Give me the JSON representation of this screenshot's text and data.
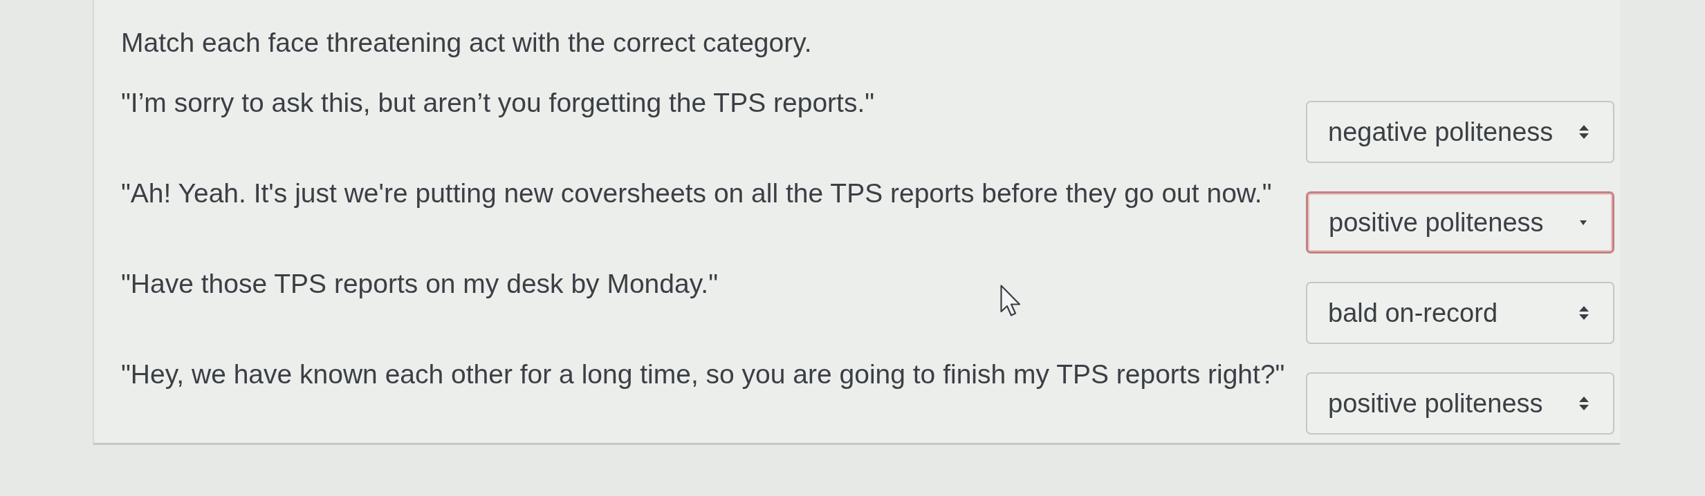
{
  "instruction": "Match each face threatening act with the correct category.",
  "items": [
    {
      "prompt": "\"I’m sorry to ask this, but aren’t you forgetting the TPS reports.\"",
      "answer": {
        "value": "negative politeness",
        "focused": false
      }
    },
    {
      "prompt": "\"Ah! Yeah. It's just we're putting new coversheets on all the TPS reports before they go out now.\"",
      "answer": {
        "value": "positive politeness",
        "focused": true
      }
    },
    {
      "prompt": "\"Have those TPS reports on my desk by Monday.\"",
      "answer": {
        "value": "bald on-record",
        "focused": false
      }
    },
    {
      "prompt": "\"Hey, we have known each other for a long time, so you are going to finish my TPS reports right?\"",
      "answer": {
        "value": "positive politeness",
        "focused": false
      }
    }
  ]
}
